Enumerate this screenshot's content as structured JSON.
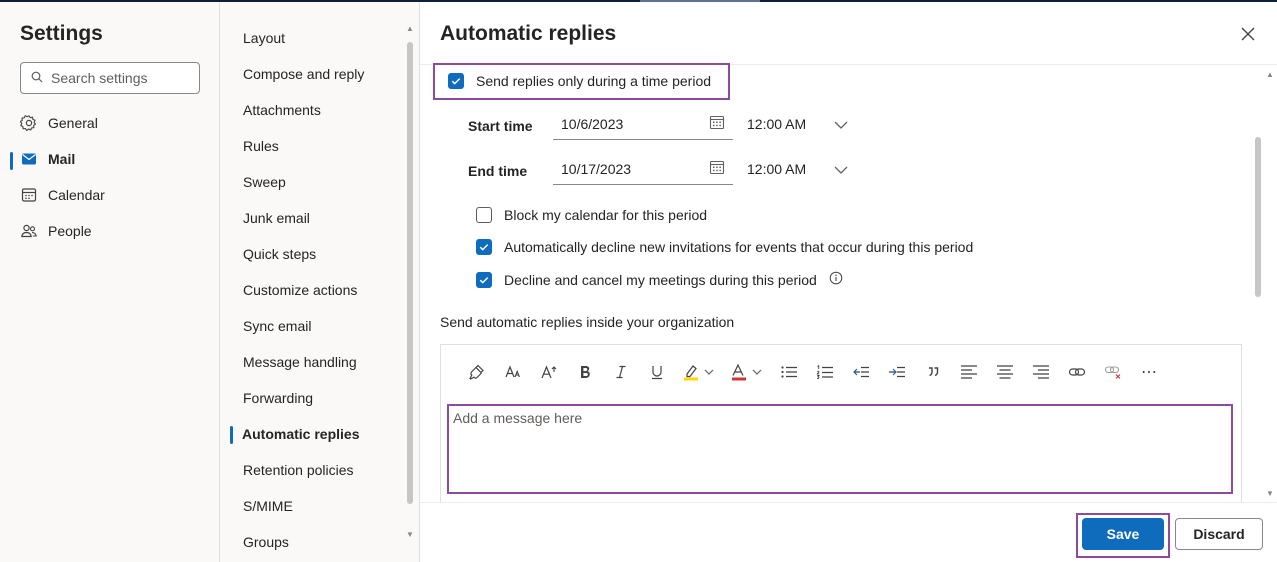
{
  "colors": {
    "accent": "#0f6cbd",
    "highlight_box": "#8e4b9c"
  },
  "settings": {
    "title": "Settings",
    "search_placeholder": "Search settings",
    "categories": [
      {
        "label": "General",
        "icon": "gear-icon"
      },
      {
        "label": "Mail",
        "icon": "mail-icon",
        "active": true
      },
      {
        "label": "Calendar",
        "icon": "calendar-icon"
      },
      {
        "label": "People",
        "icon": "people-icon"
      }
    ]
  },
  "nav": {
    "items": [
      {
        "label": "Layout"
      },
      {
        "label": "Compose and reply"
      },
      {
        "label": "Attachments"
      },
      {
        "label": "Rules"
      },
      {
        "label": "Sweep"
      },
      {
        "label": "Junk email"
      },
      {
        "label": "Quick steps"
      },
      {
        "label": "Customize actions"
      },
      {
        "label": "Sync email"
      },
      {
        "label": "Message handling"
      },
      {
        "label": "Forwarding"
      },
      {
        "label": "Automatic replies",
        "active": true
      },
      {
        "label": "Retention policies"
      },
      {
        "label": "S/MIME"
      },
      {
        "label": "Groups"
      }
    ]
  },
  "panel": {
    "title": "Automatic replies",
    "time_period_label": "Send replies only during a time period",
    "time_period_checked": true,
    "start_label": "Start time",
    "start_date": "10/6/2023",
    "start_time": "12:00 AM",
    "end_label": "End time",
    "end_date": "10/17/2023",
    "end_time": "12:00 AM",
    "options": [
      {
        "label": "Block my calendar for this period",
        "checked": false
      },
      {
        "label": "Automatically decline new invitations for events that occur during this period",
        "checked": true
      },
      {
        "label": "Decline and cancel my meetings during this period",
        "checked": true
      }
    ],
    "inside_org_label": "Send automatic replies inside your organization",
    "message_placeholder": "Add a message here",
    "toolbar_more": "⋯"
  },
  "footer": {
    "save": "Save",
    "discard": "Discard"
  }
}
